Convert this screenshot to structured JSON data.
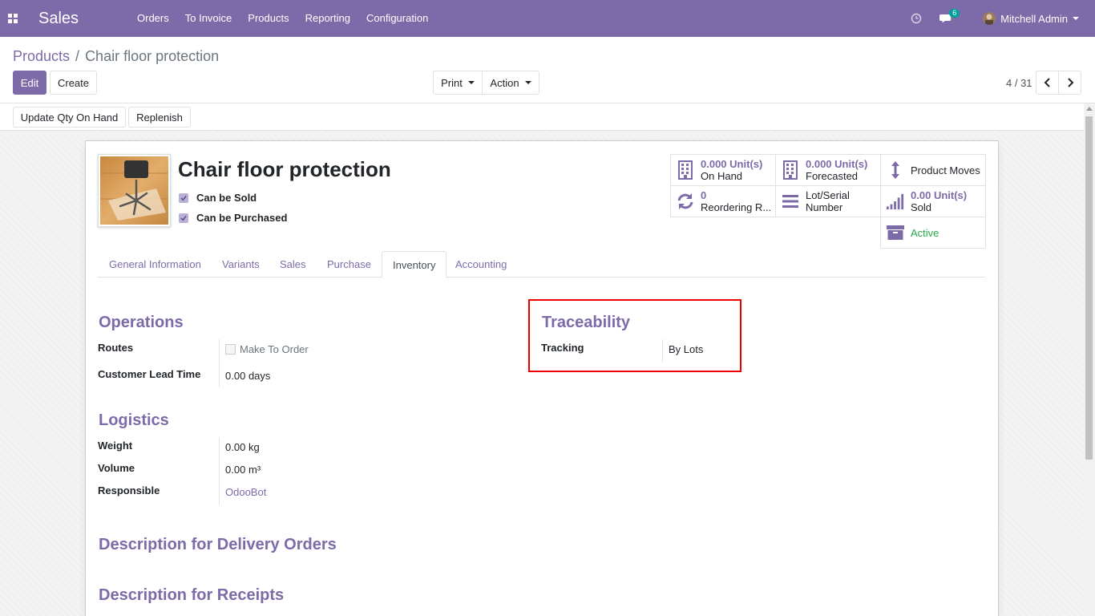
{
  "navbar": {
    "app_name": "Sales",
    "menu": [
      "Orders",
      "To Invoice",
      "Products",
      "Reporting",
      "Configuration"
    ],
    "chat_count": "6",
    "user_name": "Mitchell Admin",
    "icons": {
      "apps": "apps-grid-icon",
      "clock": "clock-icon",
      "chat": "chat-icon"
    }
  },
  "breadcrumb": {
    "parent": "Products",
    "separator": "/",
    "current": "Chair floor protection"
  },
  "control_panel": {
    "edit_label": "Edit",
    "create_label": "Create",
    "print_label": "Print",
    "action_label": "Action",
    "pager": "4 / 31"
  },
  "status_bar": {
    "update_qty_label": "Update Qty On Hand",
    "replenish_label": "Replenish"
  },
  "product": {
    "name": "Chair floor protection",
    "can_be_sold_label": "Can be Sold",
    "can_be_purchased_label": "Can be Purchased",
    "can_be_sold": true,
    "can_be_purchased": true
  },
  "smart_buttons": {
    "on_hand": {
      "value": "0.000",
      "unit": "Unit(s)",
      "label": "On Hand"
    },
    "forecasted": {
      "value": "0.000",
      "unit": "Unit(s)",
      "label": "Forecasted"
    },
    "product_moves": {
      "label": "Product Moves"
    },
    "reordering": {
      "value": "0",
      "label": "Reordering R..."
    },
    "lot_serial": {
      "line1": "Lot/Serial",
      "line2": "Number"
    },
    "sold": {
      "value": "0.00",
      "unit": "Unit(s)",
      "label": "Sold"
    },
    "active": {
      "label": "Active"
    }
  },
  "tabs": [
    "General Information",
    "Variants",
    "Sales",
    "Purchase",
    "Inventory",
    "Accounting"
  ],
  "active_tab": "Inventory",
  "operations": {
    "title": "Operations",
    "routes_label": "Routes",
    "make_to_order_label": "Make To Order",
    "lead_time_label": "Customer Lead Time",
    "lead_time_value": "0.00",
    "lead_time_unit": "days"
  },
  "traceability": {
    "title": "Traceability",
    "tracking_label": "Tracking",
    "tracking_value": "By Lots"
  },
  "logistics": {
    "title": "Logistics",
    "weight_label": "Weight",
    "weight_value": "0.00",
    "weight_unit": "kg",
    "volume_label": "Volume",
    "volume_value": "0.00",
    "volume_unit": "m³",
    "responsible_label": "Responsible",
    "responsible_value": "OdooBot"
  },
  "descriptions": {
    "delivery_title": "Description for Delivery Orders",
    "receipts_title": "Description for Receipts"
  },
  "colors": {
    "brand": "#7c6ba8",
    "active_green": "#28a745",
    "highlight": "#e00000"
  }
}
